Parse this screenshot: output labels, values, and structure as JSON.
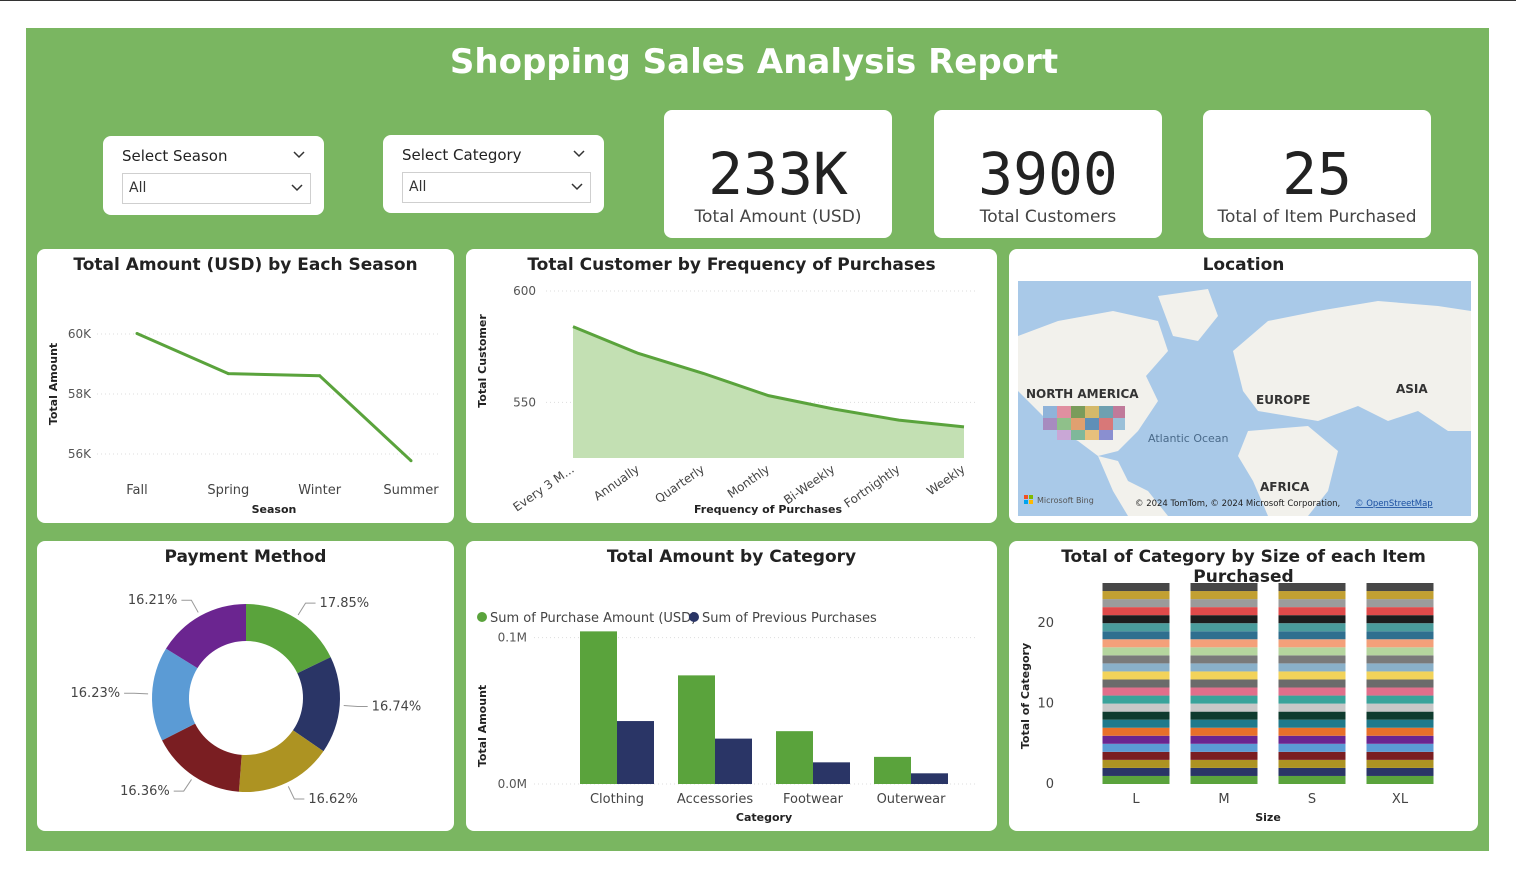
{
  "report_title": "Shopping  Sales Analysis Report",
  "slicers": [
    {
      "label": "Select Season",
      "value": "All"
    },
    {
      "label": "Select Category",
      "value": "All"
    }
  ],
  "kpis": [
    {
      "value": "233K",
      "label": "Total Amount (USD)"
    },
    {
      "value": "3900",
      "label": "Total Customers"
    },
    {
      "value": "25",
      "label": "Total of Item Purchased"
    }
  ],
  "colors": {
    "background": "#7ab661",
    "line": "#5aa33c",
    "area": "#c3e0b3",
    "bar_green": "#5aa33c",
    "bar_navy": "#2a3566"
  },
  "map": {
    "title": "Location",
    "labels": [
      "NORTH AMERICA",
      "EUROPE",
      "ASIA",
      "Atlantic Ocean",
      "AFRICA"
    ],
    "attribution": "© 2024 TomTom, © 2024 Microsoft Corporation,",
    "attribution_link": "© OpenStreetMap",
    "provider": "Microsoft Bing"
  },
  "chart_data": [
    {
      "type": "line",
      "title": "Total Amount (USD) by Each Season",
      "xlabel": "Season",
      "ylabel": "Total Amount",
      "categories": [
        "Fall",
        "Spring",
        "Winter",
        "Summer"
      ],
      "values": [
        60018,
        58679,
        58607,
        55777
      ],
      "ylim": [
        55000,
        61000
      ],
      "yticks": [
        56000,
        58000,
        60000
      ],
      "ytick_labels": [
        "56K",
        "58K",
        "60K"
      ]
    },
    {
      "type": "area",
      "title": "Total Customer by Frequency of Purchases",
      "xlabel": "Frequency of Purchases",
      "ylabel": "Total Customer",
      "categories": [
        "Every 3 M...",
        "Annually",
        "Quarterly",
        "Monthly",
        "Bi-Weekly",
        "Fortnightly",
        "Weekly"
      ],
      "values": [
        584,
        572,
        563,
        553,
        547,
        542,
        539
      ],
      "ylim": [
        525,
        600
      ],
      "yticks": [
        550,
        600
      ],
      "ytick_labels": [
        "550",
        "600"
      ]
    },
    {
      "type": "pie",
      "title": "Payment Method",
      "slices": [
        {
          "label": "17.85%",
          "value": 17.85,
          "color": "#5aa33c"
        },
        {
          "label": "16.74%",
          "value": 16.74,
          "color": "#2a3566"
        },
        {
          "label": "16.62%",
          "value": 16.62,
          "color": "#ad9322"
        },
        {
          "label": "16.36%",
          "value": 16.36,
          "color": "#7a1e22"
        },
        {
          "label": "16.23%",
          "value": 16.23,
          "color": "#5b9bd5"
        },
        {
          "label": "16.21%",
          "value": 16.21,
          "color": "#6b2590"
        }
      ]
    },
    {
      "type": "bar",
      "title": "Total Amount by Category",
      "xlabel": "Category",
      "ylabel": "Total Amount",
      "categories": [
        "Clothing",
        "Accessories",
        "Footwear",
        "Outerwear"
      ],
      "series": [
        {
          "name": "Sum of Purchase Amount (USD)",
          "values": [
            104264,
            74200,
            36093,
            18524
          ],
          "color": "#5aa33c"
        },
        {
          "name": "Sum of Previous Purchases",
          "values": [
            43000,
            31000,
            14800,
            7300
          ],
          "color": "#2a3566"
        }
      ],
      "ylim": [
        0,
        125000
      ],
      "yticks": [
        0,
        100000
      ],
      "ytick_labels": [
        "0.0M",
        "0.1M"
      ]
    },
    {
      "type": "bar",
      "stacked": true,
      "title": "Total of Category by Size of each Item Purchased",
      "xlabel": "Size",
      "ylabel": "Total of Category",
      "categories": [
        "L",
        "M",
        "S",
        "XL"
      ],
      "segments_per_bar": 25,
      "segment_value": 1,
      "segment_colors": [
        "#5aa33c",
        "#2a3566",
        "#ad9322",
        "#7a1e22",
        "#5b9bd5",
        "#6b2590",
        "#e8702a",
        "#1f7a8c",
        "#0f3b2e",
        "#c8c8c8",
        "#3aa39b",
        "#e06f8b",
        "#6b6b6b",
        "#f2d35a",
        "#8ab0c9",
        "#7a7a7a",
        "#b5d59e",
        "#f4a07a",
        "#2f6f8f",
        "#4a9c9c",
        "#1d1d1d",
        "#e04a4a",
        "#9b9b9b",
        "#c2a032",
        "#474747"
      ],
      "ylim": [
        0,
        25
      ],
      "yticks": [
        0,
        10,
        20
      ],
      "ytick_labels": [
        "0",
        "10",
        "20"
      ]
    }
  ]
}
